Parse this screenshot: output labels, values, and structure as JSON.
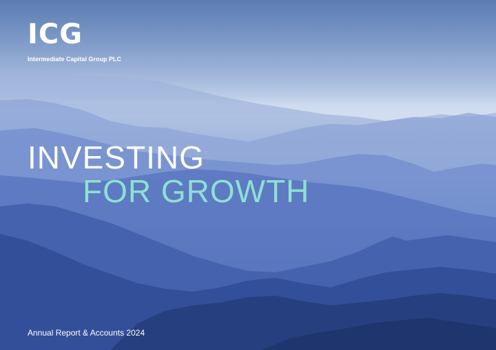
{
  "brand": {
    "logo_text": "ICG",
    "company_name": "Intermediate Capital Group PLC"
  },
  "headline": {
    "line1": "INVESTING",
    "line2": "FOR GROWTH"
  },
  "footer": {
    "document_title": "Annual Report & Accounts 2024"
  },
  "colors": {
    "headline_primary": "#ffffff",
    "headline_accent": "#8ee0d0",
    "mountain_dark": "#26407f"
  }
}
